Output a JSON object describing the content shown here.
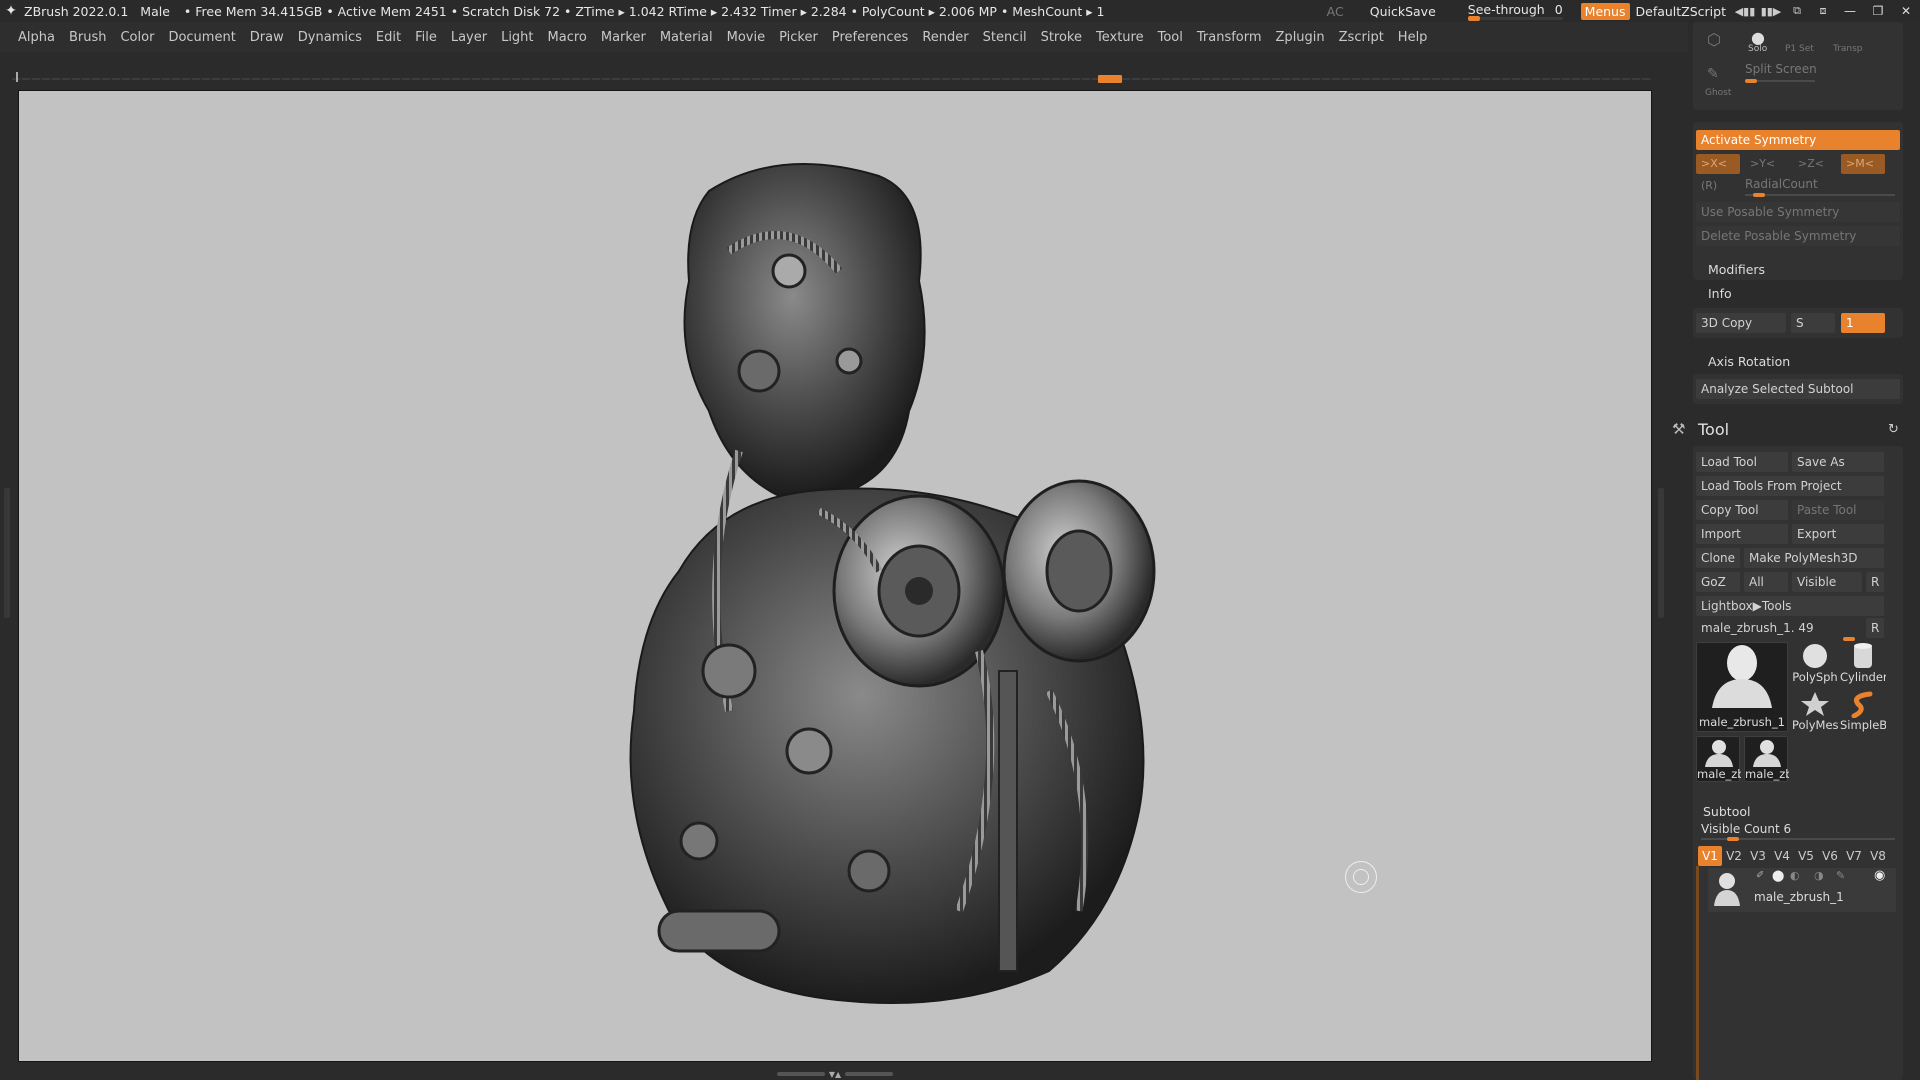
{
  "titlebar": {
    "app": "ZBrush 2022.0.1",
    "document": "Male",
    "stats": "• Free Mem 34.415GB • Active Mem 2451 • Scratch Disk 72 • ZTime ▸ 1.042 RTime ▸ 2.432 Timer ▸ 2.284 • PolyCount ▸ 2.006 MP • MeshCount ▸ 1",
    "ac": "AC",
    "quicksave": "QuickSave",
    "seethrough": "See-through",
    "seethrough_value": "0",
    "menus": "Menus",
    "script": "DefaultZScript"
  },
  "menubar": [
    "Alpha",
    "Brush",
    "Color",
    "Document",
    "Draw",
    "Dynamics",
    "Edit",
    "File",
    "Layer",
    "Light",
    "Macro",
    "Marker",
    "Material",
    "Movie",
    "Picker",
    "Preferences",
    "Render",
    "Stencil",
    "Stroke",
    "Texture",
    "Tool",
    "Transform",
    "Zplugin",
    "Zscript",
    "Help"
  ],
  "toptools": {
    "solo": "Solo",
    "polyframe": "P1 Set",
    "transp": "Transp",
    "ghost": "Ghost",
    "split_screen": "Split Screen"
  },
  "symmetry": {
    "activate": "Activate Symmetry",
    "x": ">X<",
    "y": ">Y<",
    "z": ">Z<",
    "m": ">M<",
    "r": "(R)",
    "radial": "RadialCount",
    "posable": "Use Posable Symmetry",
    "delete_posable": "Delete Posable Symmetry"
  },
  "sections": {
    "modifiers": "Modifiers",
    "info": "Info",
    "copy3d": "3D Copy",
    "s": "S",
    "value": "1",
    "axis_rotation": "Axis Rotation",
    "analyze": "Analyze Selected Subtool"
  },
  "tool": {
    "title": "Tool",
    "load_tool": "Load Tool",
    "save_as": "Save As",
    "load_from_project": "Load Tools From Project",
    "copy_tool": "Copy Tool",
    "paste_tool": "Paste Tool",
    "import": "Import",
    "export": "Export",
    "clone": "Clone",
    "make_polymesh": "Make PolyMesh3D",
    "goz": "GoZ",
    "all": "All",
    "visible": "Visible",
    "r": "R",
    "lightbox": "Lightbox▶Tools",
    "current_tool": "male_zbrush_1. 49",
    "thumbs": {
      "main": "male_zbrush_1",
      "polysphere": "PolySph",
      "cylinder": "Cylinder",
      "polymesh": "PolyMes",
      "simplebrush": "SimpleB",
      "small1": "male_zb",
      "small2": "male_zb"
    }
  },
  "subtool": {
    "title": "Subtool",
    "visible_count": "Visible Count 6",
    "tabs": [
      "V1",
      "V2",
      "V3",
      "V4",
      "V5",
      "V6",
      "V7",
      "V8"
    ],
    "item_name": "male_zbrush_1"
  },
  "colors": {
    "accent": "#e8822d",
    "viewport": "#c2c2c2",
    "panel": "#2b2b2b"
  }
}
